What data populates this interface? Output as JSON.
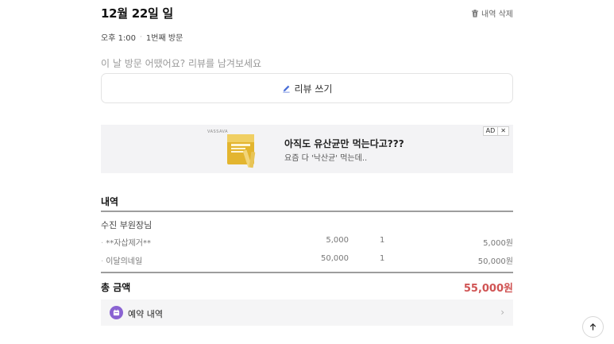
{
  "header": {
    "date_title": "12월 22일 일",
    "delete_label": "내역 삭제"
  },
  "visit": {
    "time": "오후 1:00",
    "separator": "·",
    "visit_count": "1번째 방문"
  },
  "review": {
    "prompt": "이 날 방문 어땠어요? 리뷰를 남겨보세요",
    "button_label": "리뷰 쓰기"
  },
  "ad": {
    "brand": "VASSAVA",
    "title": "아직도 유산균만 먹는다고???",
    "subtitle": "요즘 다 '낙산균' 먹는데..",
    "badge": "AD",
    "close": "✕"
  },
  "details": {
    "section_title": "내역",
    "group_name": "수진 부원장님",
    "items": [
      {
        "bullet": "·",
        "name": "**자삽제거**",
        "price": "5,000",
        "qty": "1",
        "amount": "5,000원"
      },
      {
        "bullet": "·",
        "name": "이달의네일",
        "price": "50,000",
        "qty": "1",
        "amount": "50,000원"
      }
    ]
  },
  "total": {
    "label": "총 금액",
    "value": "55,000원"
  },
  "reservation": {
    "label": "예약 내역",
    "chevron": "›"
  },
  "colors": {
    "accent_purple": "#8a63d2",
    "total_red": "#d05454",
    "ad_background": "#f3f3f5"
  },
  "icons": {
    "delete": "trash-icon",
    "review": "pencil-icon",
    "reservation": "calendar-icon",
    "scroll_top": "arrow-up-icon"
  }
}
